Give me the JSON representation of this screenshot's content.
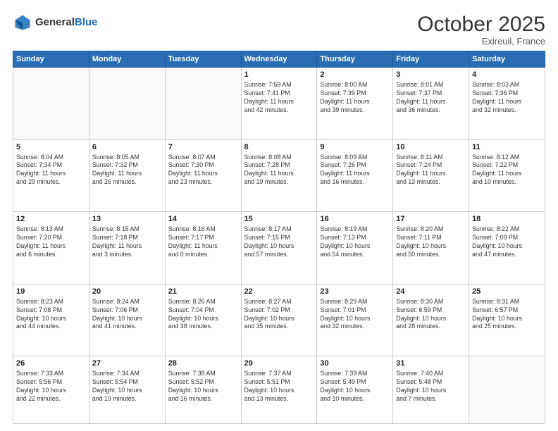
{
  "header": {
    "logo_general": "General",
    "logo_blue": "Blue",
    "month_title": "October 2025",
    "location": "Exireuil, France"
  },
  "weekdays": [
    "Sunday",
    "Monday",
    "Tuesday",
    "Wednesday",
    "Thursday",
    "Friday",
    "Saturday"
  ],
  "weeks": [
    [
      {
        "day": "",
        "info": ""
      },
      {
        "day": "",
        "info": ""
      },
      {
        "day": "",
        "info": ""
      },
      {
        "day": "1",
        "info": "Sunrise: 7:59 AM\nSunset: 7:41 PM\nDaylight: 11 hours\nand 42 minutes."
      },
      {
        "day": "2",
        "info": "Sunrise: 8:00 AM\nSunset: 7:39 PM\nDaylight: 11 hours\nand 39 minutes."
      },
      {
        "day": "3",
        "info": "Sunrise: 8:01 AM\nSunset: 7:37 PM\nDaylight: 11 hours\nand 36 minutes."
      },
      {
        "day": "4",
        "info": "Sunrise: 8:03 AM\nSunset: 7:36 PM\nDaylight: 11 hours\nand 32 minutes."
      }
    ],
    [
      {
        "day": "5",
        "info": "Sunrise: 8:04 AM\nSunset: 7:34 PM\nDaylight: 11 hours\nand 29 minutes."
      },
      {
        "day": "6",
        "info": "Sunrise: 8:05 AM\nSunset: 7:32 PM\nDaylight: 11 hours\nand 26 minutes."
      },
      {
        "day": "7",
        "info": "Sunrise: 8:07 AM\nSunset: 7:30 PM\nDaylight: 11 hours\nand 23 minutes."
      },
      {
        "day": "8",
        "info": "Sunrise: 8:08 AM\nSunset: 7:28 PM\nDaylight: 11 hours\nand 19 minutes."
      },
      {
        "day": "9",
        "info": "Sunrise: 8:09 AM\nSunset: 7:26 PM\nDaylight: 11 hours\nand 16 minutes."
      },
      {
        "day": "10",
        "info": "Sunrise: 8:11 AM\nSunset: 7:24 PM\nDaylight: 11 hours\nand 13 minutes."
      },
      {
        "day": "11",
        "info": "Sunrise: 8:12 AM\nSunset: 7:22 PM\nDaylight: 11 hours\nand 10 minutes."
      }
    ],
    [
      {
        "day": "12",
        "info": "Sunrise: 8:13 AM\nSunset: 7:20 PM\nDaylight: 11 hours\nand 6 minutes."
      },
      {
        "day": "13",
        "info": "Sunrise: 8:15 AM\nSunset: 7:18 PM\nDaylight: 11 hours\nand 3 minutes."
      },
      {
        "day": "14",
        "info": "Sunrise: 8:16 AM\nSunset: 7:17 PM\nDaylight: 11 hours\nand 0 minutes."
      },
      {
        "day": "15",
        "info": "Sunrise: 8:17 AM\nSunset: 7:15 PM\nDaylight: 10 hours\nand 57 minutes."
      },
      {
        "day": "16",
        "info": "Sunrise: 8:19 AM\nSunset: 7:13 PM\nDaylight: 10 hours\nand 54 minutes."
      },
      {
        "day": "17",
        "info": "Sunrise: 8:20 AM\nSunset: 7:11 PM\nDaylight: 10 hours\nand 50 minutes."
      },
      {
        "day": "18",
        "info": "Sunrise: 8:22 AM\nSunset: 7:09 PM\nDaylight: 10 hours\nand 47 minutes."
      }
    ],
    [
      {
        "day": "19",
        "info": "Sunrise: 8:23 AM\nSunset: 7:08 PM\nDaylight: 10 hours\nand 44 minutes."
      },
      {
        "day": "20",
        "info": "Sunrise: 8:24 AM\nSunset: 7:06 PM\nDaylight: 10 hours\nand 41 minutes."
      },
      {
        "day": "21",
        "info": "Sunrise: 8:26 AM\nSunset: 7:04 PM\nDaylight: 10 hours\nand 38 minutes."
      },
      {
        "day": "22",
        "info": "Sunrise: 8:27 AM\nSunset: 7:02 PM\nDaylight: 10 hours\nand 35 minutes."
      },
      {
        "day": "23",
        "info": "Sunrise: 8:29 AM\nSunset: 7:01 PM\nDaylight: 10 hours\nand 32 minutes."
      },
      {
        "day": "24",
        "info": "Sunrise: 8:30 AM\nSunset: 6:59 PM\nDaylight: 10 hours\nand 28 minutes."
      },
      {
        "day": "25",
        "info": "Sunrise: 8:31 AM\nSunset: 6:57 PM\nDaylight: 10 hours\nand 25 minutes."
      }
    ],
    [
      {
        "day": "26",
        "info": "Sunrise: 7:33 AM\nSunset: 5:56 PM\nDaylight: 10 hours\nand 22 minutes."
      },
      {
        "day": "27",
        "info": "Sunrise: 7:34 AM\nSunset: 5:54 PM\nDaylight: 10 hours\nand 19 minutes."
      },
      {
        "day": "28",
        "info": "Sunrise: 7:36 AM\nSunset: 5:52 PM\nDaylight: 10 hours\nand 16 minutes."
      },
      {
        "day": "29",
        "info": "Sunrise: 7:37 AM\nSunset: 5:51 PM\nDaylight: 10 hours\nand 13 minutes."
      },
      {
        "day": "30",
        "info": "Sunrise: 7:39 AM\nSunset: 5:49 PM\nDaylight: 10 hours\nand 10 minutes."
      },
      {
        "day": "31",
        "info": "Sunrise: 7:40 AM\nSunset: 5:48 PM\nDaylight: 10 hours\nand 7 minutes."
      },
      {
        "day": "",
        "info": ""
      }
    ]
  ]
}
